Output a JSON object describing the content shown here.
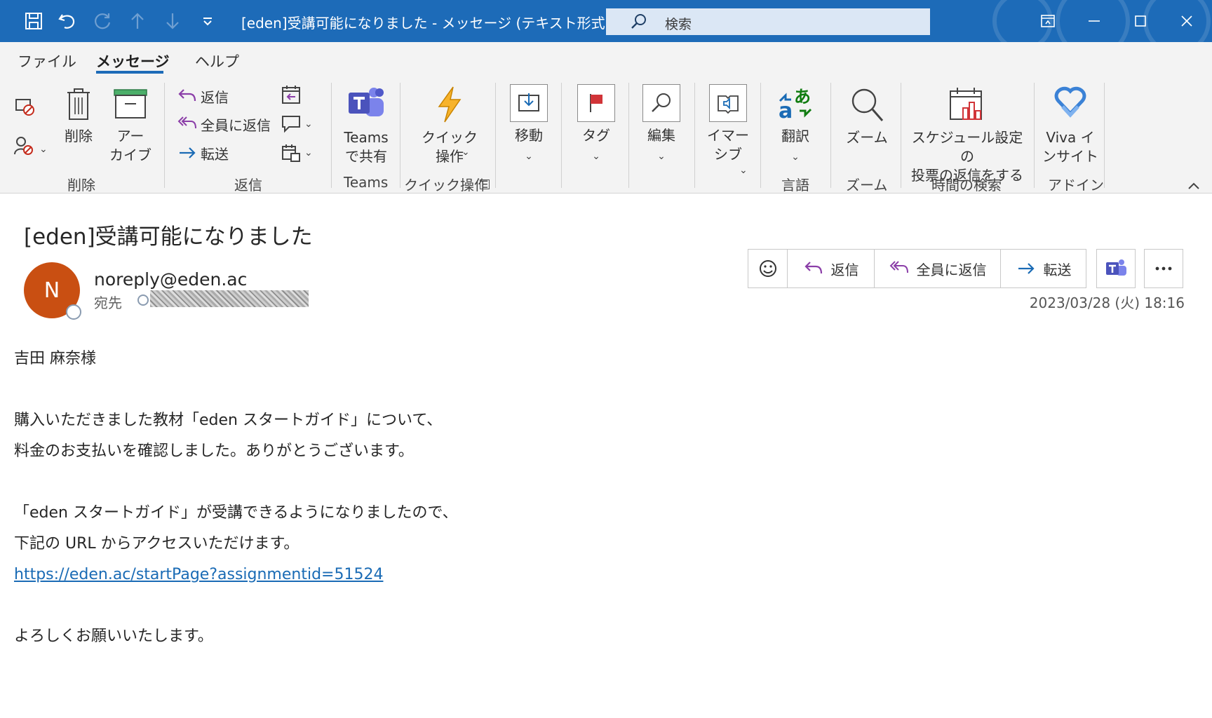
{
  "titlebar": {
    "title": "[eden]受講可能になりました  -  メッセージ (テキスト形式)",
    "search_placeholder": "検索",
    "color": "#1d6bb8"
  },
  "tabs": [
    {
      "label": "ファイル"
    },
    {
      "label": "メッセージ",
      "active": true
    },
    {
      "label": "ヘルプ"
    }
  ],
  "ribbon": {
    "delete_label": "削除",
    "archive_label": "アー\nカイブ",
    "reply_label": "返信",
    "reply_all_label": "全員に返信",
    "forward_label": "転送",
    "teams_share_label": "Teams\nで共有",
    "quick_action_label": "クイック\n操作",
    "move_label": "移動",
    "tag_label": "タグ",
    "edit_label": "編集",
    "immersive_label": "イマー\nシブ",
    "translate_label": "翻訳",
    "zoom_label": "ズーム",
    "schedule_label": "スケジュール設定の\n投票の返信をする",
    "viva_label": "Viva イ\nンサイト",
    "groups": {
      "delete": "削除",
      "reply": "返信",
      "teams": "Teams",
      "quick": "クイック操作",
      "language": "言語",
      "zoom": "ズーム",
      "time_search": "時間の検索",
      "addin": "アドイン"
    }
  },
  "message": {
    "subject": "[eden]受講可能になりました",
    "avatar_initial": "N",
    "avatar_color": "#c94f12",
    "sender": "noreply@eden.ac",
    "to_label": "宛先",
    "actions": {
      "reply": "返信",
      "reply_all": "全員に返信",
      "forward": "転送"
    },
    "timestamp": "2023/03/28 (火) 18:16",
    "body": {
      "greeting": "吉田 麻奈様",
      "line1": "購入いただきました教材「eden スタートガイド」について、",
      "line2": "料金のお支払いを確認しました。ありがとうございます。",
      "line3": "「eden スタートガイド」が受講できるようになりましたので、",
      "line4": "下記の URL からアクセスいただけます。",
      "link": "https://eden.ac/startPage?assignmentid=51524",
      "closing": "よろしくお願いいたします。"
    }
  }
}
